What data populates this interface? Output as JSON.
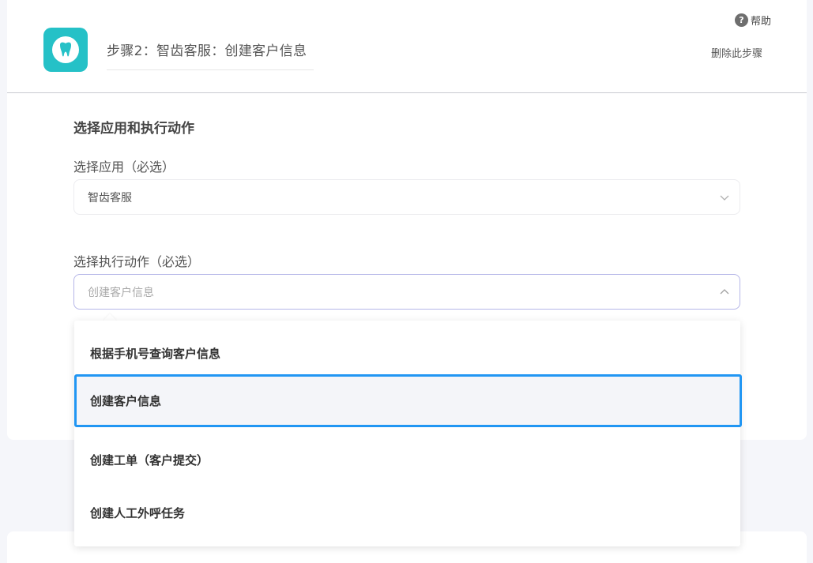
{
  "header": {
    "step_title": "步骤2：智齿客服：创建客户信息",
    "help_label": "帮助",
    "help_icon": "?",
    "delete_label": "删除此步骤",
    "app_icon": "tooth-icon",
    "app_icon_color": "#25c1c7"
  },
  "section": {
    "title": "选择应用和执行动作"
  },
  "app_select": {
    "label": "选择应用（必选）",
    "value": "智齿客服"
  },
  "action_select": {
    "label": "选择执行动作（必选）",
    "placeholder": "创建客户信息",
    "expanded": true
  },
  "dropdown": {
    "options": [
      {
        "label": "根据手机号查询客户信息",
        "selected": false
      },
      {
        "label": "创建客户信息",
        "selected": true
      },
      {
        "label": "创建工单（客户提交）",
        "selected": false
      },
      {
        "label": "创建人工外呼任务",
        "selected": false
      }
    ],
    "highlight_color": "#2196f3"
  }
}
